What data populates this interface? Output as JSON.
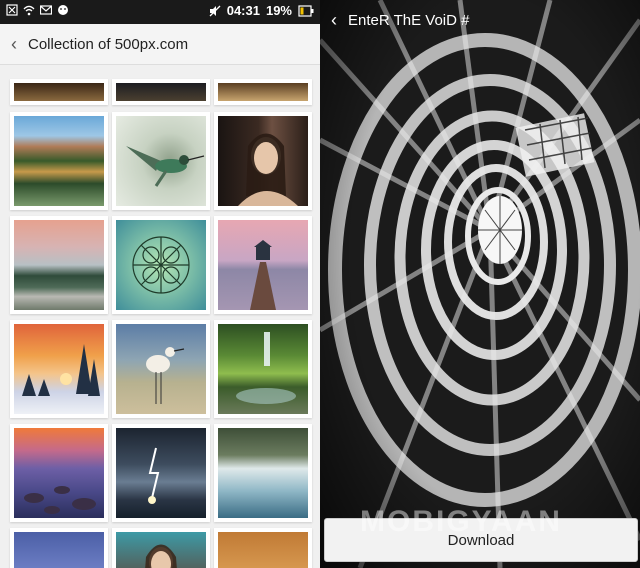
{
  "status_bar": {
    "time": "04:31",
    "battery": "19%",
    "icons": [
      "sim-off-icon",
      "wifi-icon",
      "gmail-icon",
      "android-icon",
      "mute-icon",
      "battery-icon"
    ]
  },
  "app_bar": {
    "title": "Collection of 500px.com",
    "back_icon": "chevron-left-icon"
  },
  "grid": {
    "rows": [
      [
        "warm-blur",
        "dark-blur",
        "warm-blur-2"
      ],
      [
        "mountain-lake",
        "hummingbird",
        "woman-portrait"
      ],
      [
        "misty-lake",
        "leaf-macro",
        "boathouse-pier"
      ],
      [
        "snowy-sunset",
        "bird-wader",
        "waterfall-forest"
      ],
      [
        "purple-rocks",
        "lightning-storm",
        "blue-falls"
      ],
      [
        "sky-gradient",
        "girl-portrait",
        "orange-sky"
      ]
    ]
  },
  "detail": {
    "title": "EnteR ThE VoiD #",
    "download_label": "Download",
    "watermark": "MOBIGYAAN"
  }
}
